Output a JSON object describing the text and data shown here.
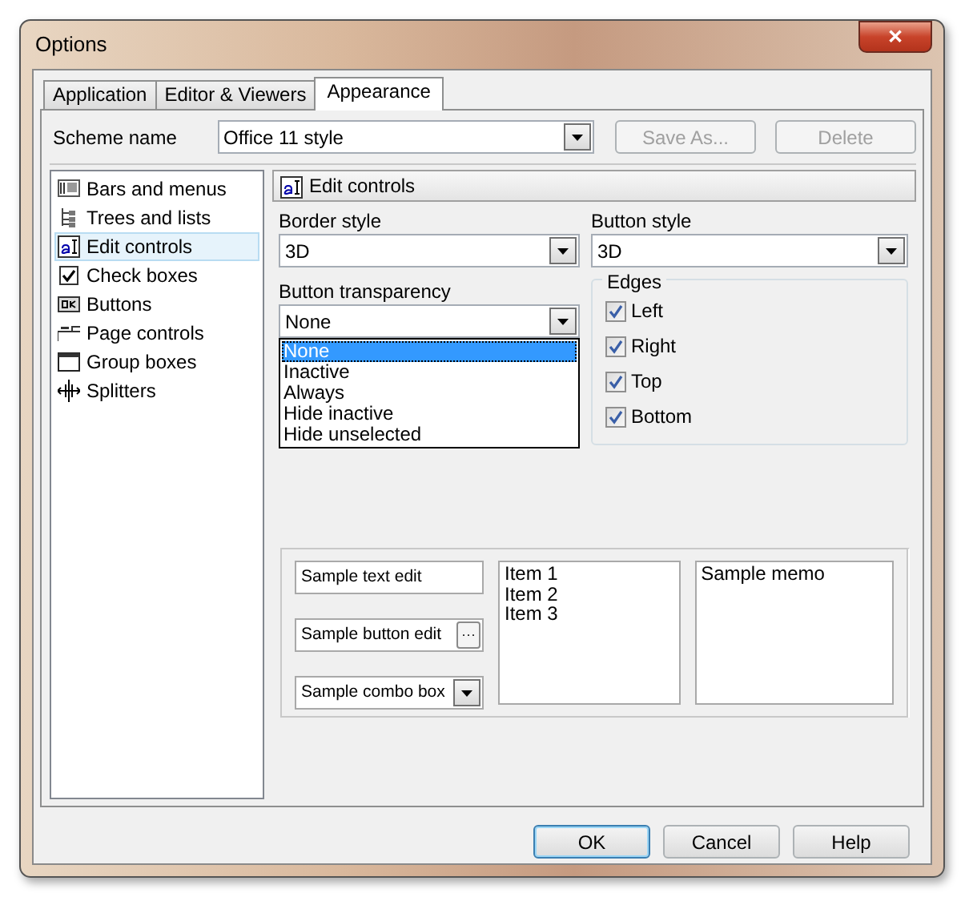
{
  "window": {
    "title": "Options",
    "close": "✕"
  },
  "tabs": [
    {
      "label": "Application",
      "selected": false
    },
    {
      "label": "Editor & Viewers",
      "selected": false
    },
    {
      "label": "Appearance",
      "selected": true
    }
  ],
  "scheme": {
    "label": "Scheme name",
    "value": "Office 11 style",
    "buttons": [
      {
        "label": "Save As...",
        "disabled": true
      },
      {
        "label": "Delete",
        "disabled": true
      }
    ]
  },
  "categories": [
    {
      "label": "Bars and menus",
      "kind": "bars",
      "selected": false
    },
    {
      "label": "Trees and lists",
      "kind": "tree",
      "selected": false
    },
    {
      "label": "Edit controls",
      "kind": "edit",
      "selected": true
    },
    {
      "label": "Check boxes",
      "kind": "check",
      "selected": false
    },
    {
      "label": "Buttons",
      "kind": "button",
      "selected": false
    },
    {
      "label": "Page controls",
      "kind": "page",
      "selected": false
    },
    {
      "label": "Group boxes",
      "kind": "group",
      "selected": false
    },
    {
      "label": "Splitters",
      "kind": "splitter",
      "selected": false
    }
  ],
  "section_title": "Edit controls",
  "border_style": {
    "label": "Border style",
    "value": "3D"
  },
  "button_style": {
    "label": "Button style",
    "value": "3D"
  },
  "button_transparency": {
    "label": "Button transparency",
    "value": "None",
    "expanded": true,
    "options": [
      {
        "label": "None",
        "selected": true
      },
      {
        "label": "Inactive",
        "selected": false
      },
      {
        "label": "Always",
        "selected": false
      },
      {
        "label": "Hide inactive",
        "selected": false
      },
      {
        "label": "Hide unselected",
        "selected": false
      }
    ]
  },
  "edges": {
    "title": "Edges",
    "items": [
      {
        "label": "Left",
        "checked": true
      },
      {
        "label": "Right",
        "checked": true
      },
      {
        "label": "Top",
        "checked": true
      },
      {
        "label": "Bottom",
        "checked": true
      }
    ]
  },
  "samples": {
    "text_edit": "Sample text edit",
    "button_edit": "Sample button edit",
    "button_edit_button": "···",
    "combo": "Sample combo box",
    "list_items": [
      "Item 1",
      "Item 2",
      "Item 3"
    ],
    "memo": "Sample memo"
  },
  "buttons": [
    {
      "label": "OK",
      "default": true
    },
    {
      "label": "Cancel",
      "default": false
    },
    {
      "label": "Help",
      "default": false
    }
  ]
}
